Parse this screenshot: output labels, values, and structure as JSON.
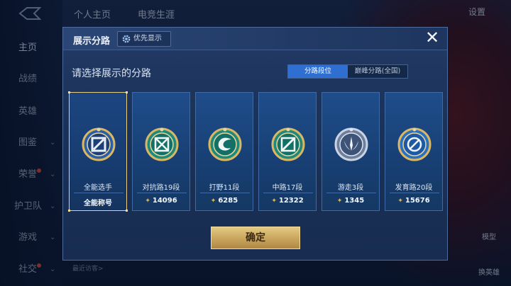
{
  "background": {
    "top_tabs": [
      "个人主页",
      "电竞生涯"
    ],
    "settings_label": "设置",
    "nav_items": [
      {
        "label": "主页",
        "has_chevron": false
      },
      {
        "label": "战绩",
        "has_chevron": false
      },
      {
        "label": "英雄",
        "has_chevron": false
      },
      {
        "label": "图鉴",
        "has_chevron": true
      },
      {
        "label": "荣誉",
        "has_chevron": true
      },
      {
        "label": "护卫队",
        "has_chevron": true
      },
      {
        "label": "游戏",
        "has_chevron": true
      },
      {
        "label": "社交",
        "has_chevron": true
      }
    ],
    "visitor_text": "最近访客>",
    "side_buttons": [
      "模型",
      "换英雄"
    ]
  },
  "dialog": {
    "title": "展示分路",
    "priority_label": "优先显示",
    "close_icon": "close-icon",
    "prompt": "请选择展示的分路",
    "tabs": {
      "active": "分路段位",
      "inactive": "巅峰分路(全国)"
    },
    "cards": [
      {
        "name": "全能选手",
        "label": "全能称号",
        "icon": "all-round-emblem-icon",
        "selected": true
      },
      {
        "name": "对抗路19段",
        "score": "14096",
        "icon": "clash-lane-emblem-icon",
        "selected": false
      },
      {
        "name": "打野11段",
        "score": "6285",
        "icon": "jungle-emblem-icon",
        "selected": false
      },
      {
        "name": "中路17段",
        "score": "12322",
        "icon": "mid-lane-emblem-icon",
        "selected": false
      },
      {
        "name": "游走3段",
        "score": "1345",
        "icon": "roam-emblem-icon",
        "selected": false
      },
      {
        "name": "发育路20段",
        "score": "15676",
        "icon": "farm-lane-emblem-icon",
        "selected": false
      }
    ],
    "confirm_label": "确定"
  },
  "colors": {
    "accent_blue": "#2f6fd1",
    "gold": "#e9cf86",
    "card_bg": "#1f4d8a"
  }
}
